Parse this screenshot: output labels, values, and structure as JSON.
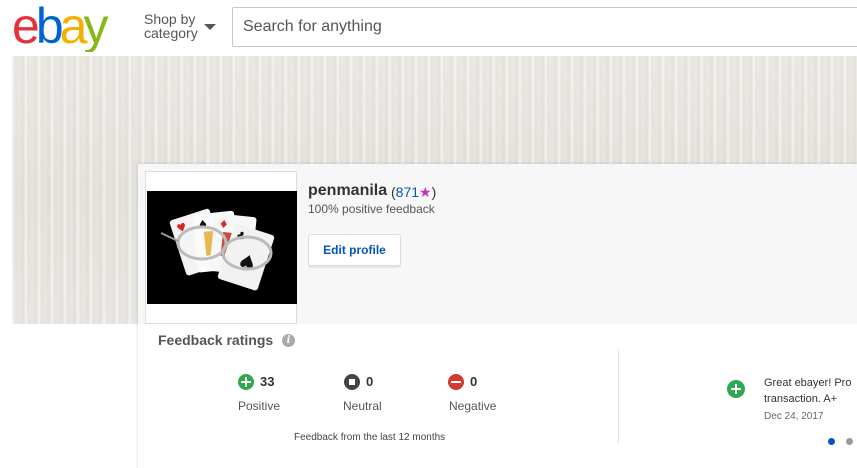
{
  "header": {
    "logo": {
      "e": "e",
      "b": "b",
      "a": "a",
      "y": "y"
    },
    "shop_by_line1": "Shop by",
    "shop_by_line2": "category",
    "search_placeholder": "Search for anything"
  },
  "profile": {
    "username": "penmanila",
    "score_open": "(",
    "score": "871",
    "star": "★",
    "score_close": ")",
    "positive_feedback": "100% positive feedback",
    "edit_label": "Edit profile"
  },
  "feedback": {
    "title": "Feedback ratings",
    "info_glyph": "i",
    "ratings": [
      {
        "count": "33",
        "label": "Positive"
      },
      {
        "count": "0",
        "label": "Neutral"
      },
      {
        "count": "0",
        "label": "Negative"
      }
    ],
    "period": "Feedback from the last 12 months",
    "comment": {
      "text": "Great ebayer! Pro transaction. A+",
      "date": "Dec 24, 2017"
    }
  }
}
